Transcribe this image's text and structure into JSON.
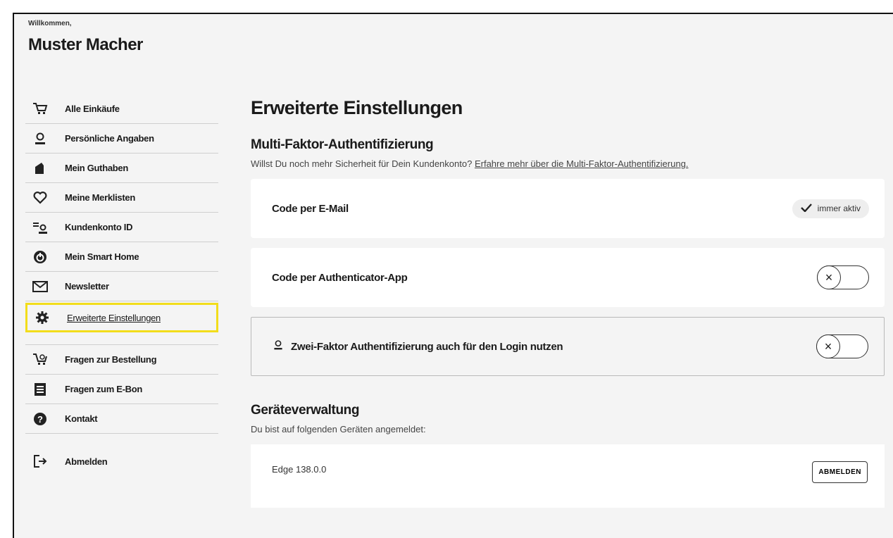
{
  "header": {
    "welcome": "Willkommen,",
    "name": "Muster Macher"
  },
  "sidebar": {
    "items": [
      {
        "label": "Alle Einkäufe",
        "icon": "cart-icon"
      },
      {
        "label": "Persönliche Angaben",
        "icon": "user-icon"
      },
      {
        "label": "Mein Guthaben",
        "icon": "wallet-icon"
      },
      {
        "label": "Meine Merklisten",
        "icon": "heart-icon"
      },
      {
        "label": "Kundenkonto ID",
        "icon": "id-card-icon"
      },
      {
        "label": "Mein Smart Home",
        "icon": "smart-home-icon"
      },
      {
        "label": "Newsletter",
        "icon": "envelope-icon"
      },
      {
        "label": "Erweiterte Einstellungen",
        "icon": "gear-icon",
        "active": true
      }
    ],
    "help": [
      {
        "label": "Fragen zur Bestellung",
        "icon": "cart-at-icon"
      },
      {
        "label": "Fragen zum E-Bon",
        "icon": "receipt-icon"
      },
      {
        "label": "Kontakt",
        "icon": "question-icon"
      }
    ],
    "logout": {
      "label": "Abmelden",
      "icon": "logout-icon"
    }
  },
  "main": {
    "title": "Erweiterte Einstellungen",
    "mfa": {
      "title": "Multi-Faktor-Authentifizierung",
      "desc": "Willst Du noch mehr Sicherheit für Dein Kundenkonto?",
      "link": "Erfahre mehr über die Multi-Faktor-Authentifizierung.",
      "options": [
        {
          "label": "Code per E-Mail",
          "badge": "immer aktiv"
        },
        {
          "label": "Code per Authenticator-App",
          "enabled": false
        },
        {
          "label": "Zwei-Faktor Authentifizierung auch für den Login nutzen",
          "enabled": false
        }
      ]
    },
    "devices": {
      "title": "Geräteverwaltung",
      "desc": "Du bist auf folgenden Geräten angemeldet:",
      "items": [
        {
          "name": "Edge 138.0.0",
          "action": "ABMELDEN"
        }
      ]
    }
  },
  "colors": {
    "accent": "#f2dd1b",
    "background": "#f4f4f4",
    "card": "#ffffff",
    "text": "#1a1a1a"
  }
}
